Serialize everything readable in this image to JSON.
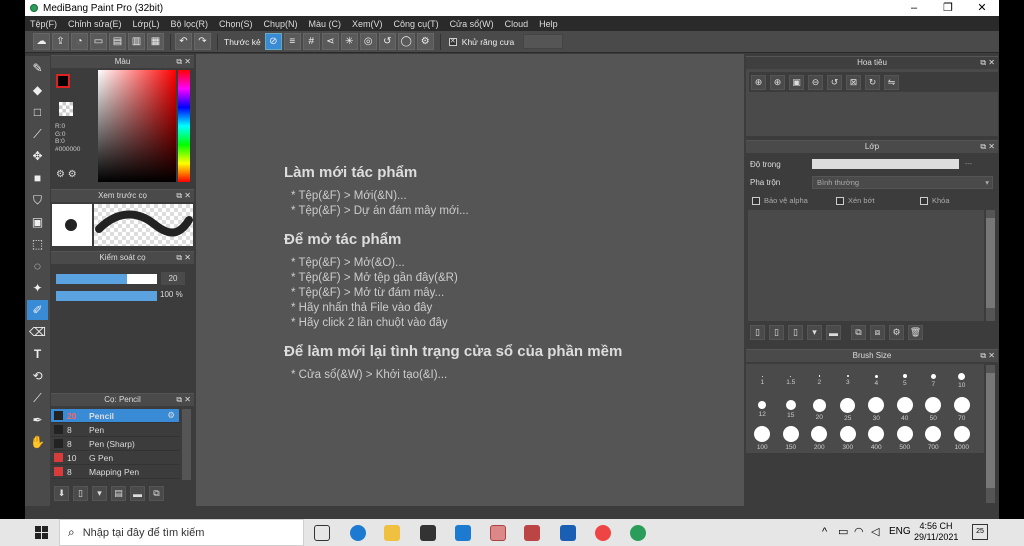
{
  "window": {
    "title": "MediBang Paint Pro (32bit)",
    "minimize": "–",
    "maximize": "❐",
    "close": "✕"
  },
  "menu": [
    "Tệp(F)",
    "Chỉnh sửa(E)",
    "Lớp(L)",
    "Bộ lọc(R)",
    "Chọn(S)",
    "Chụp(N)",
    "Màu (C)",
    "Xem(V)",
    "Công cụ(T)",
    "Cửa sổ(W)",
    "Cloud",
    "Help"
  ],
  "toolbar": {
    "ruler_label": "Thước kẻ",
    "antialias_label": "Khử răng cưa",
    "antialias_checked": "✕"
  },
  "color_panel": {
    "title": "Màu",
    "r": "R:0",
    "g": "G:0",
    "b": "B:0",
    "hex": "#000000"
  },
  "preview_panel": {
    "title": "Xem trước cọ"
  },
  "control_panel": {
    "title": "Kiểm soát cọ",
    "size": "20",
    "opacity": "100 %",
    "size_fill": 0.7,
    "opacity_fill": 1.0
  },
  "brush_panel": {
    "title": "Cọ: Pencil",
    "brushes": [
      {
        "size": "20",
        "name": "Pencil",
        "color": "#222222",
        "selected": true
      },
      {
        "size": "8",
        "name": "Pen",
        "color": "#222222",
        "selected": false
      },
      {
        "size": "8",
        "name": "Pen (Sharp)",
        "color": "#222222",
        "selected": false
      },
      {
        "size": "10",
        "name": "G Pen",
        "color": "#d93a3a",
        "selected": false
      },
      {
        "size": "8",
        "name": "Mapping Pen",
        "color": "#d93a3a",
        "selected": false
      }
    ]
  },
  "welcome": {
    "new_title": "Làm mới tác phẩm",
    "new_items": [
      "* Tệp(&F) > Mới(&N)...",
      "* Tệp(&F) > Dự án đám mây mới..."
    ],
    "open_title": "Để mở tác phẩm",
    "open_items": [
      "* Tệp(&F) > Mở(&O)...",
      "* Tệp(&F) > Mở tệp gần đây(&R)",
      "* Tệp(&F) > Mở từ đám mây...",
      "* Hãy nhấn thả File vào đây",
      "* Hãy click 2 lần chuột vào đây"
    ],
    "reset_title": "Để làm mới lại tình trạng cửa sổ của phần mềm",
    "reset_items": [
      "* Cửa sổ(&W) > Khởi tạo(&I)..."
    ]
  },
  "navigator": {
    "title": "Hoa tiêu"
  },
  "layer_panel": {
    "title": "Lớp",
    "opacity_label": "Độ trong",
    "opacity_value": "---",
    "blend_label": "Pha trộn",
    "blend_value": "Bình thường",
    "protect_alpha": "Bảo vệ alpha",
    "clipping": "Xén bớt",
    "lock": "Khóa"
  },
  "brush_size_panel": {
    "title": "Brush Size",
    "sizes": [
      {
        "label": "1",
        "d": 1
      },
      {
        "label": "1.5",
        "d": 1
      },
      {
        "label": "2",
        "d": 1.5
      },
      {
        "label": "3",
        "d": 2
      },
      {
        "label": "4",
        "d": 3
      },
      {
        "label": "5",
        "d": 4
      },
      {
        "label": "7",
        "d": 5
      },
      {
        "label": "10",
        "d": 7
      },
      {
        "label": "12",
        "d": 8
      },
      {
        "label": "15",
        "d": 10
      },
      {
        "label": "20",
        "d": 13
      },
      {
        "label": "25",
        "d": 15
      },
      {
        "label": "30",
        "d": 16
      },
      {
        "label": "40",
        "d": 16
      },
      {
        "label": "50",
        "d": 16
      },
      {
        "label": "70",
        "d": 16
      },
      {
        "label": "100",
        "d": 16
      },
      {
        "label": "150",
        "d": 16
      },
      {
        "label": "200",
        "d": 16
      },
      {
        "label": "300",
        "d": 16
      },
      {
        "label": "400",
        "d": 16
      },
      {
        "label": "500",
        "d": 16
      },
      {
        "label": "700",
        "d": 16
      },
      {
        "label": "1000",
        "d": 16
      }
    ]
  },
  "taskbar": {
    "search_placeholder": "Nhập tại đây để tìm kiếm",
    "lang": "ENG",
    "time": "4:56 CH",
    "date": "29/11/2021",
    "notifications": "25"
  }
}
